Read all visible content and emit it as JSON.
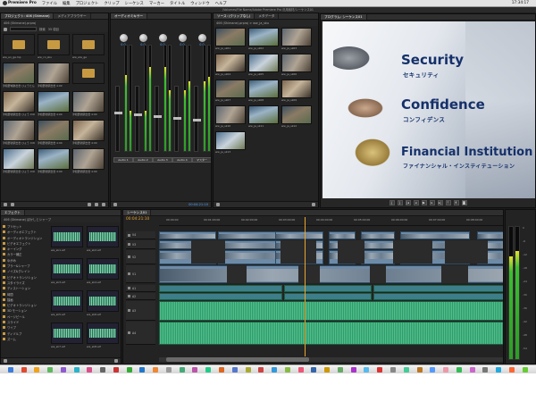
{
  "menu": {
    "app": "Premiere Pro",
    "items": [
      "ファイル",
      "編集",
      "プロジェクト",
      "クリップ",
      "シーケンス",
      "マーカー",
      "タイトル",
      "ウィンドウ",
      "ヘルプ"
    ],
    "clock": "17:34:17"
  },
  "window_title": "/Volumes/File Name/Adobe Premiere Pro 汎用素材/シーケンス01",
  "project": {
    "tabs": [
      "プロジェクト: 406 (Shimane)",
      "メディアブラウザー",
      "情報",
      "エフェクト"
    ],
    "path": "406 (Shimane).prproj",
    "search_label": "検索",
    "count": "35 項目",
    "items": [
      {
        "label": "ww_en_ga.mp",
        "type": "folder"
      },
      {
        "label": "ww_cn_sku",
        "type": "folder"
      },
      {
        "label": "ww_ww_ga",
        "type": "folder"
      },
      {
        "label": "津和野城跡出雲 ひょうたん 0:00",
        "type": "ph1"
      },
      {
        "label": "津和野宿駅出雲 4:00",
        "type": "ph2"
      },
      {
        "label": "",
        "type": "folder"
      },
      {
        "label": "津和野宿駅出雲 ひょう 0:00",
        "type": "ph4"
      },
      {
        "label": "津和野宿駅出雲 4:00",
        "type": "ph3"
      },
      {
        "label": "津和野宿駅出雲 4:00",
        "type": "ph2"
      },
      {
        "label": "津和野宿駅出雲 ひょう 0:00",
        "type": "ph2"
      },
      {
        "label": "津和野宿駅出雲 4:00",
        "type": "ph1"
      },
      {
        "label": "津和野宿駅出雲 4:00",
        "type": "ph4"
      },
      {
        "label": "津和野宿駅出雲 ひょう 0:00",
        "type": "ph5"
      },
      {
        "label": "津和野宿駅出雲 4:00",
        "type": "ph3"
      },
      {
        "label": "津和野宿駅出雲 4:00",
        "type": "ph2"
      }
    ]
  },
  "mixer": {
    "tab": "オーディオミキサー",
    "channels": [
      {
        "name": "Audio 1",
        "val": "0.0"
      },
      {
        "name": "Audio 2",
        "val": "0.0"
      },
      {
        "name": "Audio 3",
        "val": "0.0"
      },
      {
        "name": "Audio 4",
        "val": "0.0"
      },
      {
        "name": "マスター",
        "val": "0.0"
      }
    ],
    "read_labels": [
      "読み込み",
      "読み込み",
      "読み込み",
      "読み込み"
    ],
    "timecode": "00:04:21:10",
    "levels": [
      0.72,
      0.38,
      0.8,
      0.58,
      0.66,
      0.7
    ]
  },
  "source": {
    "tabs": [
      "ソース: (クリップなし)",
      "エフェクトコントロール",
      "オーディオクリップミキサー",
      "メタデータ"
    ],
    "path": "406 (Shimane).prproj > ww_ja_sku",
    "clips": [
      "ww_ja_sk01",
      "ww_ja_sk02",
      "ww_ja_sk03",
      "ww_ja_sk04",
      "ww_ja_sk05",
      "ww_ja_sk06",
      "ww_ja_sk07",
      "ww_ja_sk08",
      "ww_ja_sk09",
      "ww_ja_sk10",
      "ww_ja_sk11",
      "ww_ja_sk12",
      "ww_ja_sk13"
    ]
  },
  "program": {
    "tab": "プログラム: シーケンス01",
    "lines": [
      {
        "en": "Security",
        "jp": "セキュリティ"
      },
      {
        "en": "Confidence",
        "jp": "コンフィデンス"
      },
      {
        "en": "Financial Institution",
        "jp": "ファイナンシャル・インスティテューション"
      }
    ],
    "timecode_left": "00:04:21:10",
    "timecode_right": "00:09:32:23"
  },
  "effects": {
    "tab": "エフェクト",
    "sub": "406 (Shimane) ぼかしとシャープ",
    "tree": [
      "プリセット",
      "オーディオエフェクト",
      "オーディオトランジション",
      "ビデオエフェクト",
      "キーイング",
      "カラー補正",
      "ゆがみ",
      "ブラー&シャープ",
      "ノイズ&グレイン",
      "ビデオトランジション",
      "スタイライズ",
      "ディストーション",
      "時間",
      "描画",
      "ビデオトランジション",
      "3D モーション",
      "ページピール",
      "スライド",
      "ワイプ",
      "ディゾルブ",
      "ズーム"
    ],
    "audio_clips": [
      "wa_sk1.aif",
      "wa_sk2.aif",
      "wa_sk3.aif",
      "wa_sk4.aif",
      "wa_sk5.aif",
      "wa_sk6.aif",
      "wa_sk7.aif",
      "wa_sk8.aif"
    ]
  },
  "timeline": {
    "timecode": "00:04:21:10",
    "ruler": [
      "00:00:00",
      "00:01:00:00",
      "00:02:00:00",
      "00:03:00:00",
      "00:04:00:00",
      "00:05:00:00",
      "00:06:00:00",
      "00:07:00:00",
      "00:08:00:00",
      "00:09:00:00"
    ],
    "tracks": [
      "V4",
      "V3",
      "V2",
      "V1",
      "A1",
      "A2",
      "A3",
      "A4"
    ],
    "playhead": 0.43
  },
  "master_meter": {
    "levels": [
      0.78,
      0.82
    ],
    "scale": [
      "0",
      "-6",
      "-12",
      "-18",
      "-24",
      "-30",
      "-36",
      "-42",
      "-48",
      "-54"
    ]
  }
}
